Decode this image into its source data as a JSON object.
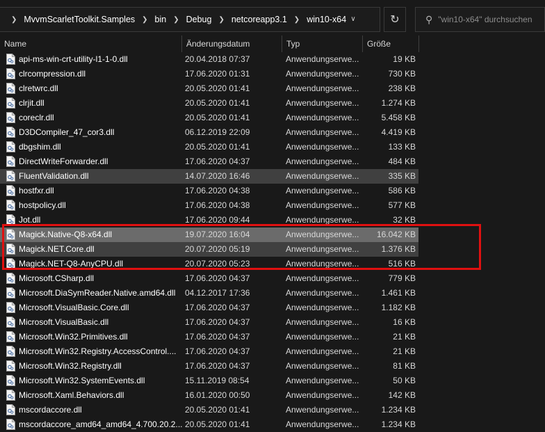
{
  "breadcrumb": [
    "MvvmScarletToolkit.Samples",
    "bin",
    "Debug",
    "netcoreapp3.1",
    "win10-x64"
  ],
  "search": {
    "placeholder": "\"win10-x64\" durchsuchen"
  },
  "columns": {
    "name": "Name",
    "date": "Änderungsdatum",
    "type": "Typ",
    "size": "Größe"
  },
  "rows": [
    {
      "name": "api-ms-win-crt-utility-l1-1-0.dll",
      "date": "20.04.2018 07:37",
      "type": "Anwendungserwe...",
      "size": "19 KB"
    },
    {
      "name": "clrcompression.dll",
      "date": "17.06.2020 01:31",
      "type": "Anwendungserwe...",
      "size": "730 KB"
    },
    {
      "name": "clretwrc.dll",
      "date": "20.05.2020 01:41",
      "type": "Anwendungserwe...",
      "size": "238 KB"
    },
    {
      "name": "clrjit.dll",
      "date": "20.05.2020 01:41",
      "type": "Anwendungserwe...",
      "size": "1.274 KB"
    },
    {
      "name": "coreclr.dll",
      "date": "20.05.2020 01:41",
      "type": "Anwendungserwe...",
      "size": "5.458 KB"
    },
    {
      "name": "D3DCompiler_47_cor3.dll",
      "date": "06.12.2019 22:09",
      "type": "Anwendungserwe...",
      "size": "4.419 KB"
    },
    {
      "name": "dbgshim.dll",
      "date": "20.05.2020 01:41",
      "type": "Anwendungserwe...",
      "size": "133 KB"
    },
    {
      "name": "DirectWriteForwarder.dll",
      "date": "17.06.2020 04:37",
      "type": "Anwendungserwe...",
      "size": "484 KB"
    },
    {
      "name": "FluentValidation.dll",
      "date": "14.07.2020 16:46",
      "type": "Anwendungserwe...",
      "size": "335 KB",
      "state": "hover"
    },
    {
      "name": "hostfxr.dll",
      "date": "17.06.2020 04:38",
      "type": "Anwendungserwe...",
      "size": "586 KB"
    },
    {
      "name": "hostpolicy.dll",
      "date": "17.06.2020 04:38",
      "type": "Anwendungserwe...",
      "size": "577 KB"
    },
    {
      "name": "Jot.dll",
      "date": "17.06.2020 09:44",
      "type": "Anwendungserwe...",
      "size": "32 KB"
    },
    {
      "name": "Magick.Native-Q8-x64.dll",
      "date": "19.07.2020 16:04",
      "type": "Anwendungserwe...",
      "size": "16.042 KB",
      "state": "selected"
    },
    {
      "name": "Magick.NET.Core.dll",
      "date": "20.07.2020 05:19",
      "type": "Anwendungserwe...",
      "size": "1.376 KB",
      "state": "hover"
    },
    {
      "name": "Magick.NET-Q8-AnyCPU.dll",
      "date": "20.07.2020 05:23",
      "type": "Anwendungserwe...",
      "size": "516 KB"
    },
    {
      "name": "Microsoft.CSharp.dll",
      "date": "17.06.2020 04:37",
      "type": "Anwendungserwe...",
      "size": "779 KB"
    },
    {
      "name": "Microsoft.DiaSymReader.Native.amd64.dll",
      "date": "04.12.2017 17:36",
      "type": "Anwendungserwe...",
      "size": "1.461 KB"
    },
    {
      "name": "Microsoft.VisualBasic.Core.dll",
      "date": "17.06.2020 04:37",
      "type": "Anwendungserwe...",
      "size": "1.182 KB"
    },
    {
      "name": "Microsoft.VisualBasic.dll",
      "date": "17.06.2020 04:37",
      "type": "Anwendungserwe...",
      "size": "16 KB"
    },
    {
      "name": "Microsoft.Win32.Primitives.dll",
      "date": "17.06.2020 04:37",
      "type": "Anwendungserwe...",
      "size": "21 KB"
    },
    {
      "name": "Microsoft.Win32.Registry.AccessControl....",
      "date": "17.06.2020 04:37",
      "type": "Anwendungserwe...",
      "size": "21 KB"
    },
    {
      "name": "Microsoft.Win32.Registry.dll",
      "date": "17.06.2020 04:37",
      "type": "Anwendungserwe...",
      "size": "81 KB"
    },
    {
      "name": "Microsoft.Win32.SystemEvents.dll",
      "date": "15.11.2019 08:54",
      "type": "Anwendungserwe...",
      "size": "50 KB"
    },
    {
      "name": "Microsoft.Xaml.Behaviors.dll",
      "date": "16.01.2020 00:50",
      "type": "Anwendungserwe...",
      "size": "142 KB"
    },
    {
      "name": "mscordaccore.dll",
      "date": "20.05.2020 01:41",
      "type": "Anwendungserwe...",
      "size": "1.234 KB"
    },
    {
      "name": "mscordaccore_amd64_amd64_4.700.20.2...",
      "date": "20.05.2020 01:41",
      "type": "Anwendungserwe...",
      "size": "1.234 KB"
    }
  ],
  "icons": {
    "file": "dll-file-icon",
    "dropdown": "chevron-down-icon",
    "refresh": "refresh-icon",
    "search": "search-icon",
    "separator": "chevron-right-icon"
  },
  "colors": {
    "background": "#191919",
    "selected": "#6b6b6b",
    "hover": "#404040",
    "annotation": "#e01010"
  }
}
